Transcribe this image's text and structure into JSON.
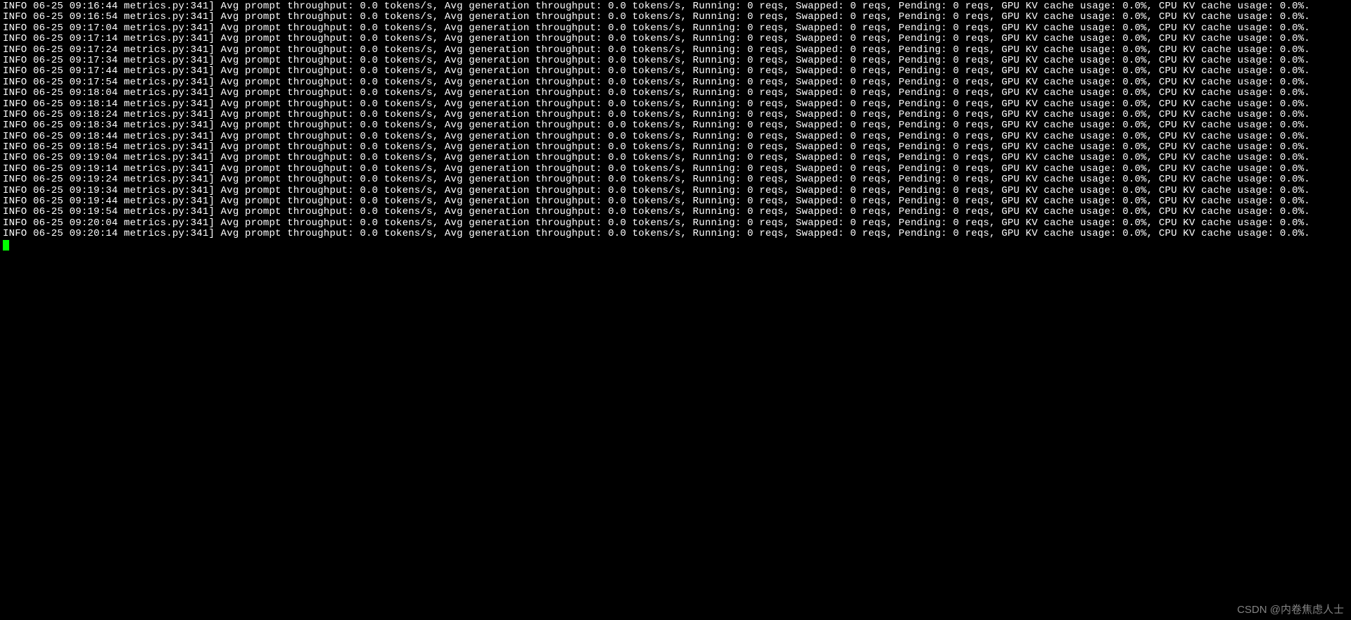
{
  "log": {
    "level": "INFO",
    "date": "06-25",
    "source": "metrics.py:341",
    "timestamps": [
      "09:16:44",
      "09:16:54",
      "09:17:04",
      "09:17:14",
      "09:17:24",
      "09:17:34",
      "09:17:44",
      "09:17:54",
      "09:18:04",
      "09:18:14",
      "09:18:24",
      "09:18:34",
      "09:18:44",
      "09:18:54",
      "09:19:04",
      "09:19:14",
      "09:19:24",
      "09:19:34",
      "09:19:44",
      "09:19:54",
      "09:20:04",
      "09:20:14"
    ],
    "metrics": {
      "avg_prompt_throughput": "0.0 tokens/s",
      "avg_generation_throughput": "0.0 tokens/s",
      "running": "0 reqs",
      "swapped": "0 reqs",
      "pending": "0 reqs",
      "gpu_kv_cache_usage": "0.0%",
      "cpu_kv_cache_usage": "0.0%"
    }
  },
  "watermark": "CSDN @内卷焦虑人士"
}
